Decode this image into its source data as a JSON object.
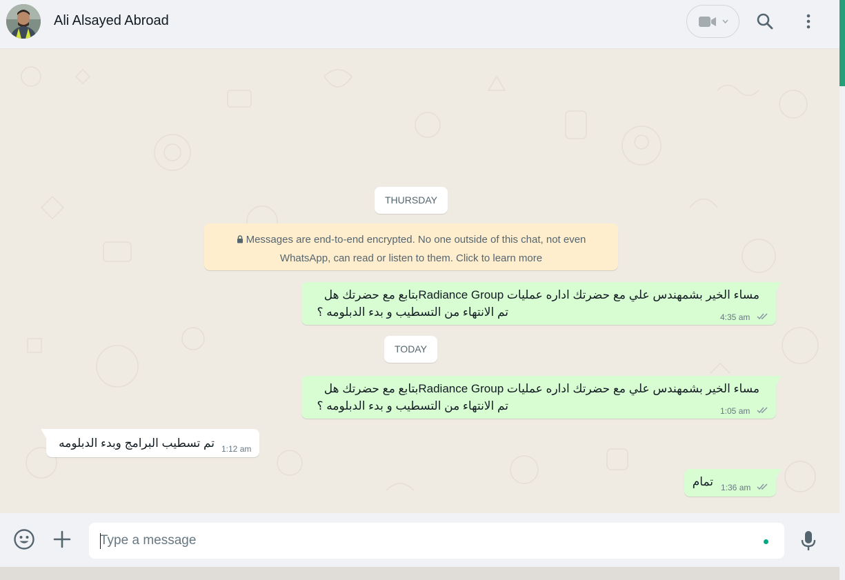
{
  "header": {
    "contact_name": "Ali Alsayed Abroad",
    "video_icon": "video-camera-icon",
    "search_icon": "search-icon",
    "menu_icon": "more-vertical-icon"
  },
  "chat": {
    "date_chips": [
      "THURSDAY",
      "TODAY"
    ],
    "encryption_notice": "Messages are end-to-end encrypted. No one outside of this chat, not even WhatsApp, can read or listen to them. Click to learn more",
    "messages": [
      {
        "direction": "outgoing",
        "line1": "مساء الخير بشمهندس علي مع  حضرتك اداره عمليات Radiance Groupبتابع مع حضرتك هل",
        "line2": "تم الانتهاء من التسطيب و بدء الدبلومه ؟",
        "time": "4:35 am",
        "status": "read"
      },
      {
        "direction": "outgoing",
        "line1": "مساء الخير بشمهندس علي مع  حضرتك اداره عمليات Radiance Groupبتابع مع حضرتك هل",
        "line2": "تم الانتهاء من التسطيب و بدء الدبلومه ؟",
        "time": "1:05 am",
        "status": "read"
      },
      {
        "direction": "incoming",
        "line1": "تم تسطيب البرامج وبدء الدبلومه",
        "time": "1:12 am"
      },
      {
        "direction": "outgoing",
        "line1": "تمام",
        "time": "1:36 am",
        "status": "read"
      }
    ]
  },
  "composer": {
    "placeholder": "Type a message",
    "emoji_icon": "emoji-icon",
    "attach_icon": "plus-icon",
    "mic_icon": "microphone-icon"
  },
  "colors": {
    "outgoing_bubble": "#d9fdd3",
    "incoming_bubble": "#ffffff",
    "chat_background": "#efeae2",
    "encryption_notice_bg": "#ffeecd",
    "accent": "#00a884"
  }
}
